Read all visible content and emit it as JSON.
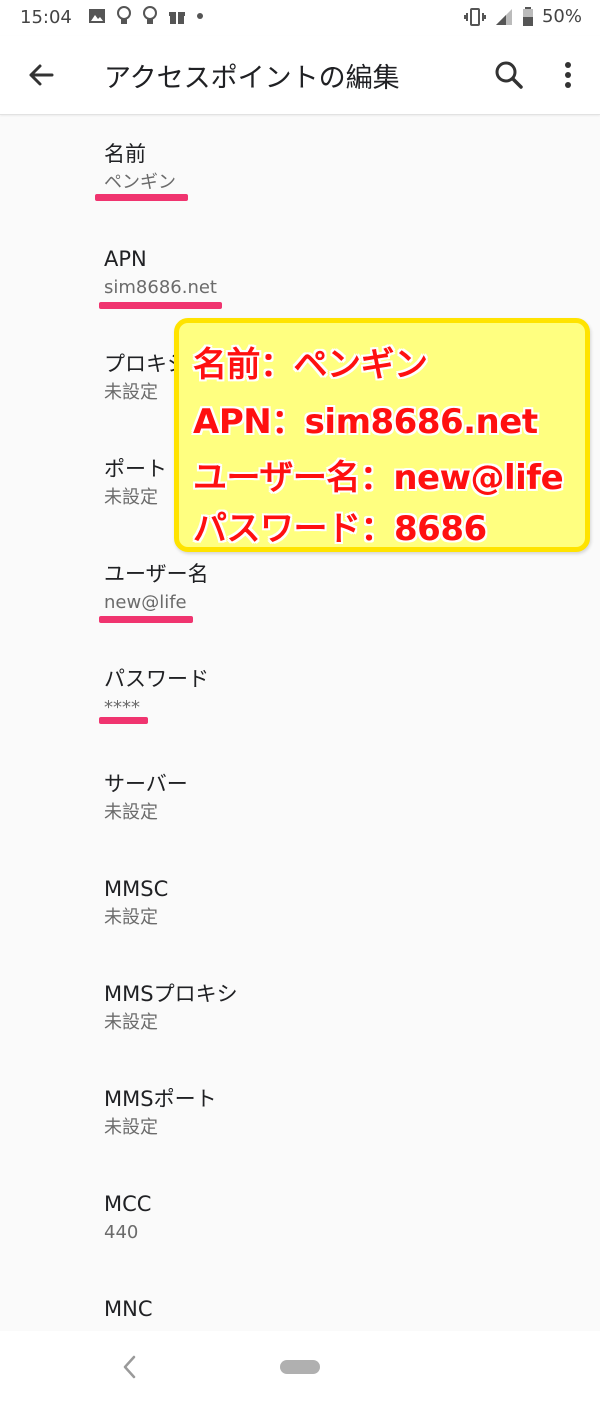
{
  "status_bar": {
    "time": "15:04",
    "battery": "50%",
    "notification_icons": [
      "image-icon",
      "bulb-icon",
      "bulb-icon",
      "gift-icon",
      "dot-icon"
    ],
    "system_icons": [
      "vibrate-icon",
      "signal-icon",
      "battery-icon"
    ]
  },
  "app_bar": {
    "title": "アクセスポイントの編集",
    "back_icon": "arrow-back-icon",
    "search_icon": "search-icon",
    "more_icon": "more-vert-icon"
  },
  "fields": [
    {
      "label": "名前",
      "value": "ペンギン"
    },
    {
      "label": "APN",
      "value": "sim8686.net"
    },
    {
      "label": "プロキシ",
      "value": "未設定"
    },
    {
      "label": "ポート",
      "value": "未設定"
    },
    {
      "label": "ユーザー名",
      "value": "new@life"
    },
    {
      "label": "パスワード",
      "value": "****"
    },
    {
      "label": "サーバー",
      "value": "未設定"
    },
    {
      "label": "MMSC",
      "value": "未設定"
    },
    {
      "label": "MMSプロキシ",
      "value": "未設定"
    },
    {
      "label": "MMSポート",
      "value": "未設定"
    },
    {
      "label": "MCC",
      "value": "440"
    },
    {
      "label": "MNC",
      "value": ""
    }
  ],
  "callout": {
    "lines": [
      "名前：ペンギン",
      "APN：sim8686.net",
      "ユーザー名：new@life",
      "パスワード：8686"
    ]
  },
  "colors": {
    "highlight_underline": "#f0346f",
    "callout_bg": "#ffff80",
    "callout_border": "#ffe300",
    "callout_text": "#ff1010"
  }
}
